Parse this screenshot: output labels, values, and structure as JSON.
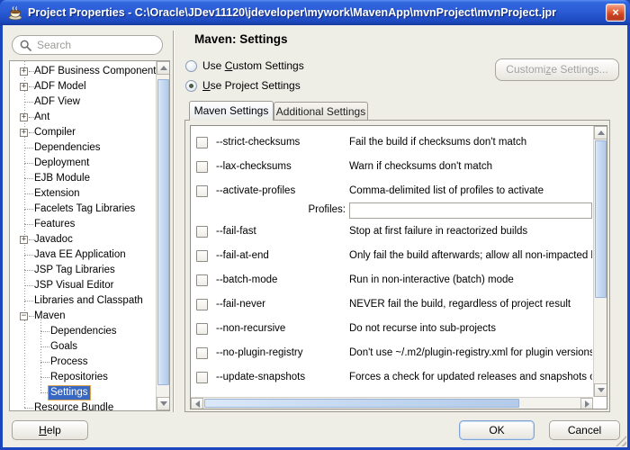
{
  "window": {
    "title": "Project Properties - C:\\Oracle\\JDev11120\\jdeveloper\\mywork\\MavenApp\\mvnProject\\mvnProject.jpr",
    "close_glyph": "×",
    "app_icon": "java-coffee-cup"
  },
  "colors": {
    "titlebar_blue": "#2a5cd6",
    "window_border": "#1c46be",
    "close_red": "#cc4524",
    "dialog_bg": "#eeede6",
    "selection_bg": "#3668c4",
    "selection_border": "#dca24c",
    "scroll_thumb": "#c3d7f0",
    "disabled_text": "#a3a3a3"
  },
  "sidebar": {
    "search_placeholder": "Search",
    "tree": [
      {
        "label": "ADF Business Components",
        "kind": "branch"
      },
      {
        "label": "ADF Model",
        "kind": "branch"
      },
      {
        "label": "ADF View",
        "kind": "leaf"
      },
      {
        "label": "Ant",
        "kind": "branch"
      },
      {
        "label": "Compiler",
        "kind": "branch"
      },
      {
        "label": "Dependencies",
        "kind": "leaf"
      },
      {
        "label": "Deployment",
        "kind": "leaf"
      },
      {
        "label": "EJB Module",
        "kind": "leaf"
      },
      {
        "label": "Extension",
        "kind": "leaf"
      },
      {
        "label": "Facelets Tag Libraries",
        "kind": "leaf"
      },
      {
        "label": "Features",
        "kind": "leaf"
      },
      {
        "label": "Javadoc",
        "kind": "branch"
      },
      {
        "label": "Java EE Application",
        "kind": "leaf"
      },
      {
        "label": "JSP Tag Libraries",
        "kind": "leaf"
      },
      {
        "label": "JSP Visual Editor",
        "kind": "leaf"
      },
      {
        "label": "Libraries and Classpath",
        "kind": "leaf"
      },
      {
        "label": "Maven",
        "kind": "open"
      },
      {
        "label": "Dependencies",
        "kind": "child"
      },
      {
        "label": "Goals",
        "kind": "child"
      },
      {
        "label": "Process",
        "kind": "child"
      },
      {
        "label": "Repositories",
        "kind": "child"
      },
      {
        "label": "Settings",
        "kind": "child",
        "selected": true
      },
      {
        "label": "Resource Bundle",
        "kind": "leaf"
      }
    ]
  },
  "main": {
    "heading": "Maven: Settings",
    "radio_custom": {
      "pre": "Use ",
      "key": "C",
      "post": "ustom Settings",
      "selected": false
    },
    "radio_project": {
      "pre": "",
      "key": "U",
      "post": "se Project Settings",
      "selected": true
    },
    "customize_button": {
      "pre": "Customi",
      "key": "z",
      "post": "e Settings...",
      "enabled": false
    },
    "tabs": [
      {
        "label": "Maven Settings",
        "active": true
      },
      {
        "label": "Additional Settings",
        "active": false
      }
    ],
    "options": [
      {
        "flag": "--strict-checksums",
        "checked": false,
        "desc": "Fail the build if checksums don't match"
      },
      {
        "flag": "--lax-checksums",
        "checked": false,
        "desc": "Warn if checksums don't match"
      },
      {
        "flag": "--activate-profiles",
        "checked": false,
        "desc": "Comma-delimited list of profiles to activate",
        "field_label": "Profiles:",
        "field_value": ""
      },
      {
        "flag": "--fail-fast",
        "checked": false,
        "desc": "Stop at first failure in reactorized builds"
      },
      {
        "flag": "--fail-at-end",
        "checked": false,
        "desc": "Only fail the build afterwards; allow all non-impacted build"
      },
      {
        "flag": "--batch-mode",
        "checked": false,
        "desc": "Run in non-interactive (batch) mode"
      },
      {
        "flag": "--fail-never",
        "checked": false,
        "desc": "NEVER fail the build, regardless of project result"
      },
      {
        "flag": "--non-recursive",
        "checked": false,
        "desc": "Do not recurse into sub-projects"
      },
      {
        "flag": "--no-plugin-registry",
        "checked": false,
        "desc": "Don't use ~/.m2/plugin-registry.xml for plugin versions"
      },
      {
        "flag": "--update-snapshots",
        "checked": false,
        "desc": "Forces a check for updated releases and snapshots on re"
      }
    ]
  },
  "footer": {
    "help": {
      "pre": "",
      "key": "H",
      "post": "elp"
    },
    "ok": "OK",
    "cancel": "Cancel"
  }
}
